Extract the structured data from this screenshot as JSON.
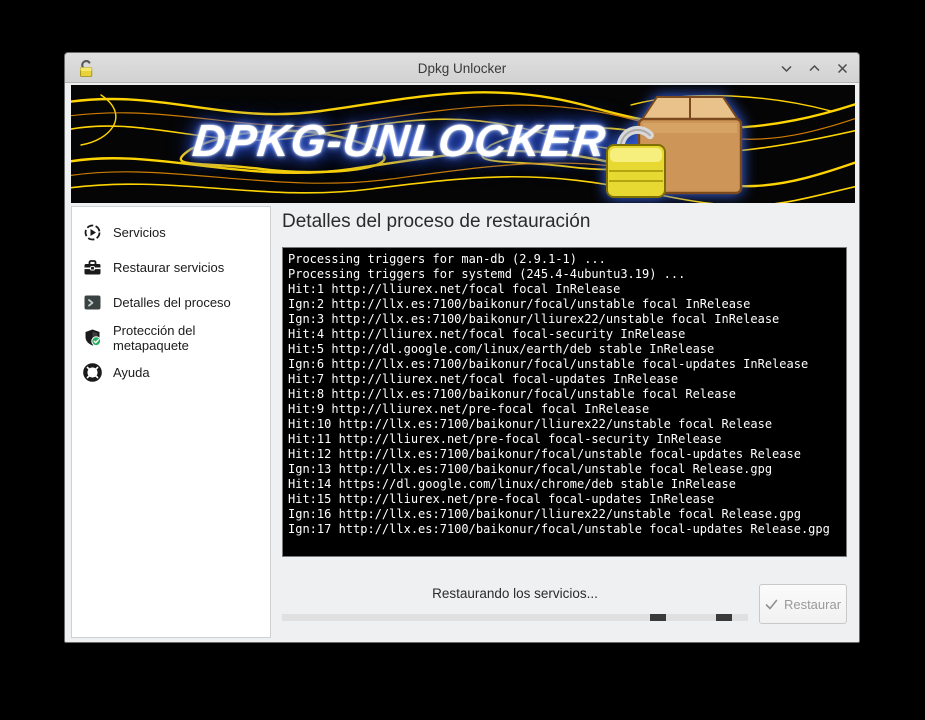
{
  "window": {
    "title": "Dpkg Unlocker"
  },
  "banner": {
    "title": "DPKG-UNLOCKER"
  },
  "sidebar": {
    "items": [
      {
        "label": "Servicios",
        "icon": "services-icon"
      },
      {
        "label": "Restaurar servicios",
        "icon": "toolbox-icon"
      },
      {
        "label": "Detalles del proceso",
        "icon": "terminal-icon"
      },
      {
        "label": "Protección del metapaquete",
        "icon": "shield-check-icon"
      },
      {
        "label": "Ayuda",
        "icon": "lifebuoy-icon"
      }
    ]
  },
  "main": {
    "heading": "Detalles del proceso de restauración",
    "terminal_lines": [
      "Processing triggers for man-db (2.9.1-1) ...",
      "Processing triggers for systemd (245.4-4ubuntu3.19) ...",
      "Hit:1 http://lliurex.net/focal focal InRelease",
      "Ign:2 http://llx.es:7100/baikonur/focal/unstable focal InRelease",
      "Ign:3 http://llx.es:7100/baikonur/lliurex22/unstable focal InRelease",
      "Hit:4 http://lliurex.net/focal focal-security InRelease",
      "Hit:5 http://dl.google.com/linux/earth/deb stable InRelease",
      "Ign:6 http://llx.es:7100/baikonur/focal/unstable focal-updates InRelease",
      "Hit:7 http://lliurex.net/focal focal-updates InRelease",
      "Hit:8 http://llx.es:7100/baikonur/focal/unstable focal Release",
      "Hit:9 http://lliurex.net/pre-focal focal InRelease",
      "Hit:10 http://llx.es:7100/baikonur/lliurex22/unstable focal Release",
      "Hit:11 http://lliurex.net/pre-focal focal-security InRelease",
      "Hit:12 http://llx.es:7100/baikonur/focal/unstable focal-updates Release",
      "Ign:13 http://llx.es:7100/baikonur/focal/unstable focal Release.gpg",
      "Hit:14 https://dl.google.com/linux/chrome/deb stable InRelease",
      "Hit:15 http://lliurex.net/pre-focal focal-updates InRelease",
      "Ign:16 http://llx.es:7100/baikonur/lliurex22/unstable focal Release.gpg",
      "Ign:17 http://llx.es:7100/baikonur/focal/unstable focal-updates Release.gpg"
    ],
    "status_text": "Restaurando los servicios...",
    "restore_button": {
      "label": "Restaurar",
      "icon": "check-icon",
      "enabled": false
    }
  },
  "progress": {
    "style": "indeterminate-busy",
    "segments": [
      {
        "left_pct": 79.0,
        "width_pct": 3.3
      },
      {
        "left_pct": 93.2,
        "width_pct": 3.3
      }
    ]
  },
  "colors": {
    "desktop_bg": "#000000",
    "window_bg": "#eff0f1",
    "titlebar_bg": "#d9d9d9",
    "flame_yellow": "#ffd400",
    "glow_blue": "#3b6cff",
    "terminal_bg": "#000000",
    "terminal_text": "#ffffff",
    "progress_chunk": "#3a3a3a",
    "disabled_text": "#9a9a9a",
    "shield_badge_green": "#27ae60"
  }
}
